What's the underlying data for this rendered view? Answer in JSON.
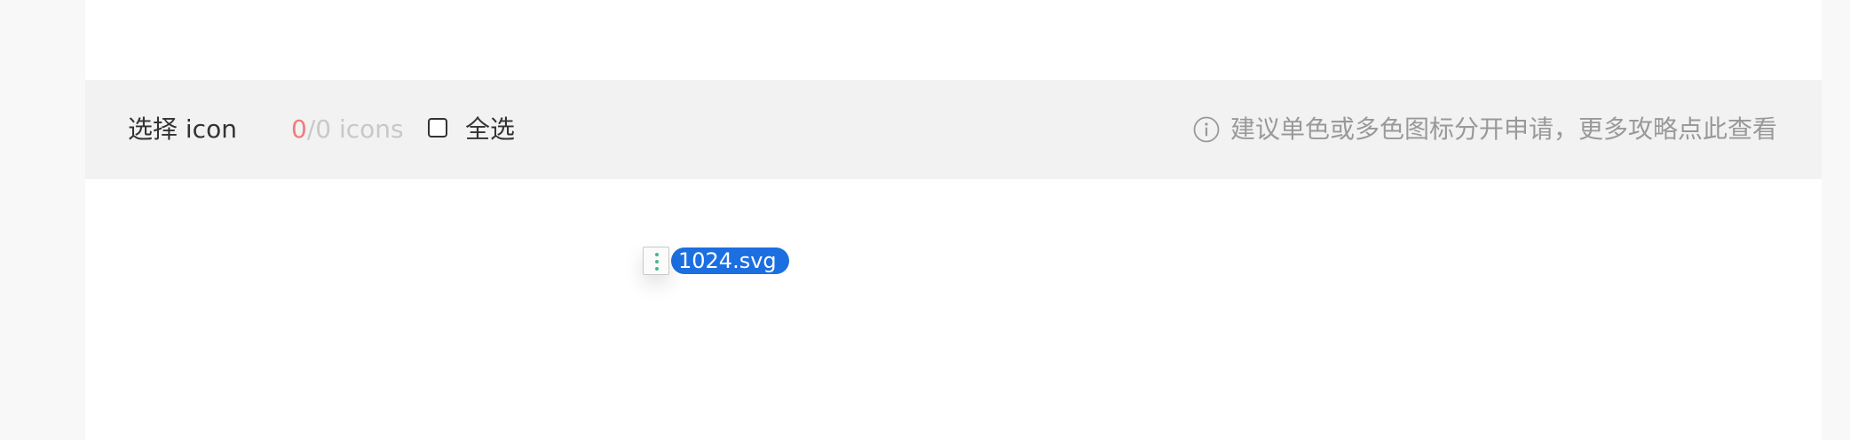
{
  "toolbar": {
    "title": "选择 icon",
    "count_selected": "0",
    "count_separator": "/",
    "count_total": "0",
    "count_unit": " icons",
    "select_all_label": "全选",
    "select_all_checked": false,
    "tip_icon": "info-circle-icon",
    "tip_text": "建议单色或多色图标分开申请，更多攻略点此查看"
  },
  "drag_ghost": {
    "file_icon": "svg-file-icon",
    "file_name": "1024.svg"
  },
  "colors": {
    "count_selected": "#f07c7c",
    "count_muted": "#c8c8c8",
    "tip_text": "#999999",
    "toolbar_bg": "#f2f2f2",
    "selection_blue": "#1c6fe0"
  }
}
